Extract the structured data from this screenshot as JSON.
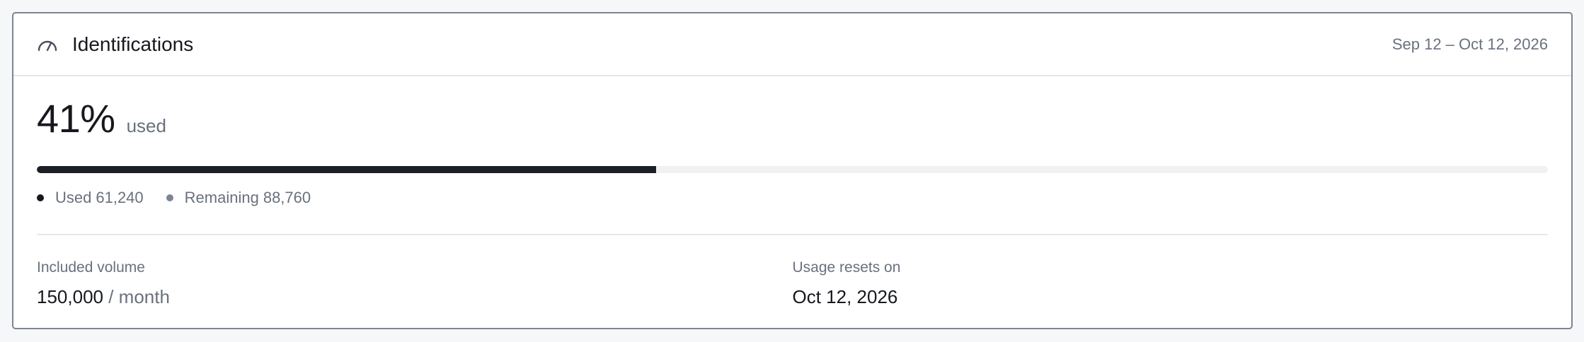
{
  "card": {
    "title": "Identifications",
    "icon": "gauge-icon",
    "period": "Sep 12 – Oct 12, 2026"
  },
  "usage": {
    "percent": "41%",
    "percent_suffix": "used",
    "used_fraction": 0.41,
    "legend": {
      "used_label": "Used",
      "used_value": "61,240",
      "remaining_label": "Remaining",
      "remaining_value": "88,760"
    }
  },
  "stats": {
    "included": {
      "label": "Included volume",
      "value": "150,000",
      "unit": "/ month"
    },
    "reset": {
      "label": "Usage resets on",
      "value": "Oct 12, 2026"
    }
  },
  "colors": {
    "bar_fill": "#1c1f26",
    "bar_track": "#f1f1f2",
    "muted_text": "#69717e",
    "card_border": "#7c8593"
  }
}
